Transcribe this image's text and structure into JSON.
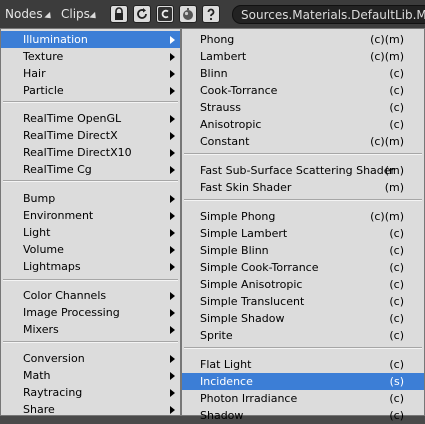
{
  "toolbar": {
    "nodes_label": "Nodes",
    "clips_label": "Clips",
    "path_text": "Sources.Materials.DefaultLib.Mate"
  },
  "icons": [
    "lock-icon",
    "refresh-icon",
    "c-icon",
    "sphere-icon",
    "help-icon"
  ],
  "colors": {
    "highlight": "#3c7ed6",
    "menu_bg": "#dcdcdc",
    "toolbar_bg": "#3c3c3c"
  },
  "menu1": [
    {
      "label": "Illumination",
      "selected": true,
      "submenu": true
    },
    {
      "label": "Texture",
      "submenu": true
    },
    {
      "label": "Hair",
      "submenu": true
    },
    {
      "label": "Particle",
      "submenu": true
    },
    {
      "label": "RealTime OpenGL",
      "submenu": true
    },
    {
      "label": "RealTime DirectX",
      "submenu": true
    },
    {
      "label": "RealTime DirectX10",
      "submenu": true
    },
    {
      "label": "RealTime Cg",
      "submenu": true
    },
    {
      "label": "Bump",
      "submenu": true
    },
    {
      "label": "Environment",
      "submenu": true
    },
    {
      "label": "Light",
      "submenu": true
    },
    {
      "label": "Volume",
      "submenu": true
    },
    {
      "label": "Lightmaps",
      "submenu": true
    },
    {
      "label": "Color Channels",
      "submenu": true
    },
    {
      "label": "Image Processing",
      "submenu": true
    },
    {
      "label": "Mixers",
      "submenu": true
    },
    {
      "label": "Conversion",
      "submenu": true
    },
    {
      "label": "Math",
      "submenu": true
    },
    {
      "label": "Raytracing",
      "submenu": true
    },
    {
      "label": "Share",
      "submenu": true
    }
  ],
  "menu2": [
    {
      "label": "Phong",
      "suffix": "(c)(m)"
    },
    {
      "label": "Lambert",
      "suffix": "(c)(m)"
    },
    {
      "label": "Blinn",
      "suffix": "(c)"
    },
    {
      "label": "Cook-Torrance",
      "suffix": "(c)"
    },
    {
      "label": "Strauss",
      "suffix": "(c)"
    },
    {
      "label": "Anisotropic",
      "suffix": "(c)"
    },
    {
      "label": "Constant",
      "suffix": "(c)(m)"
    },
    {
      "label": "Fast Sub-Surface Scattering Shader",
      "suffix": "(m)"
    },
    {
      "label": "Fast Skin Shader",
      "suffix": "(m)"
    },
    {
      "label": "Simple Phong",
      "suffix": "(c)(m)"
    },
    {
      "label": "Simple Lambert",
      "suffix": "(c)"
    },
    {
      "label": "Simple Blinn",
      "suffix": "(c)"
    },
    {
      "label": "Simple Cook-Torrance",
      "suffix": "(c)"
    },
    {
      "label": "Simple Anisotropic",
      "suffix": "(c)"
    },
    {
      "label": "Simple Translucent",
      "suffix": "(c)"
    },
    {
      "label": "Simple Shadow",
      "suffix": "(c)"
    },
    {
      "label": "Sprite",
      "suffix": "(c)"
    },
    {
      "label": "Flat Light",
      "suffix": "(c)"
    },
    {
      "label": "Incidence",
      "suffix": "(s)",
      "selected": true
    },
    {
      "label": "Photon Irradiance",
      "suffix": "(c)"
    },
    {
      "label": "Shadow",
      "suffix": "(c)"
    }
  ]
}
